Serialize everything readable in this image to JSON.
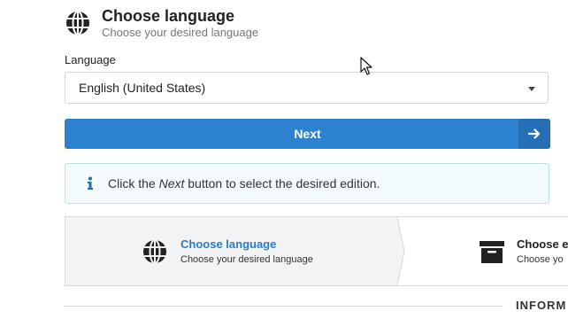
{
  "header": {
    "title": "Choose language",
    "subtitle": "Choose your desired language",
    "icon": "globe-icon"
  },
  "language_field": {
    "label": "Language",
    "selected": "English (United States)"
  },
  "next_button": {
    "label": "Next",
    "icon": "arrow-right-icon",
    "color": "#2d82d0"
  },
  "info_box": {
    "text_before": "Click the ",
    "emphasis": "Next",
    "text_after": " button to select the desired edition.",
    "icon": "info-icon"
  },
  "steps": [
    {
      "title": "Choose language",
      "subtitle": "Choose your desired language",
      "icon": "globe-icon",
      "active": true
    },
    {
      "title": "Choose ed",
      "subtitle": "Choose yo",
      "icon": "archive-box-icon",
      "active": false
    }
  ],
  "section": {
    "heading": "INFORM"
  }
}
